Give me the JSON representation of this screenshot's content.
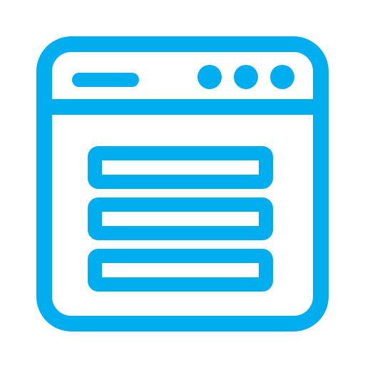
{
  "icon": {
    "name": "browser-window-list-icon",
    "accent_color": "#00AEEF",
    "window_control_dots": 3,
    "list_rows": 3
  }
}
